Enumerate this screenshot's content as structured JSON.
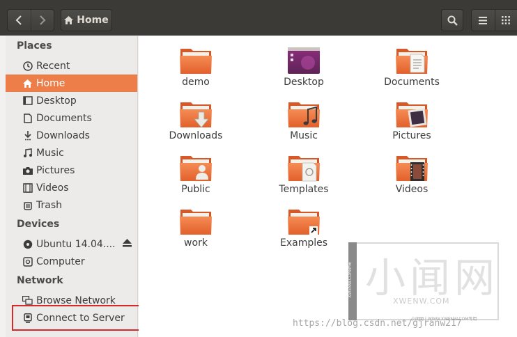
{
  "header": {
    "path_label": "Home",
    "icons": [
      "go-back-icon",
      "go-forward-icon",
      "home-icon",
      "search-icon",
      "list-view-icon",
      "grid-view-icon"
    ]
  },
  "sidebar": {
    "places_heading": "Places",
    "places": [
      {
        "label": "Recent",
        "icon": "recent-icon"
      },
      {
        "label": "Home",
        "icon": "home-icon",
        "active": true
      },
      {
        "label": "Desktop",
        "icon": "desktop-icon"
      },
      {
        "label": "Documents",
        "icon": "documents-icon"
      },
      {
        "label": "Downloads",
        "icon": "downloads-icon"
      },
      {
        "label": "Music",
        "icon": "music-icon"
      },
      {
        "label": "Pictures",
        "icon": "pictures-icon"
      },
      {
        "label": "Videos",
        "icon": "videos-icon"
      },
      {
        "label": "Trash",
        "icon": "trash-icon"
      }
    ],
    "devices_heading": "Devices",
    "devices": [
      {
        "label": "Ubuntu 14.04....",
        "icon": "disc-icon"
      },
      {
        "label": "Computer",
        "icon": "computer-icon"
      }
    ],
    "network_heading": "Network",
    "network": [
      {
        "label": "Browse Network",
        "icon": "network-icon"
      },
      {
        "label": "Connect to Server",
        "icon": "server-icon",
        "highlighted": true
      }
    ]
  },
  "files": [
    {
      "label": "demo",
      "icon": "folder-icon"
    },
    {
      "label": "Desktop",
      "icon": "desktop-folder-icon"
    },
    {
      "label": "Documents",
      "icon": "documents-folder-icon"
    },
    {
      "label": "Downloads",
      "icon": "downloads-folder-icon"
    },
    {
      "label": "Music",
      "icon": "music-folder-icon"
    },
    {
      "label": "Pictures",
      "icon": "pictures-folder-icon"
    },
    {
      "label": "Public",
      "icon": "public-folder-icon"
    },
    {
      "label": "Templates",
      "icon": "templates-folder-icon"
    },
    {
      "label": "Videos",
      "icon": "videos-folder-icon"
    },
    {
      "label": "work",
      "icon": "folder-icon"
    },
    {
      "label": "Examples",
      "icon": "examples-link-folder-icon"
    }
  ],
  "watermark": {
    "logo": "小闻网",
    "domain": "XWENW.COM",
    "strip": "小闻网 | WWW.XWENW.COM专用",
    "side": "XWENW.COM专用",
    "url": "https://blog.csdn.net/gjranw217"
  },
  "colors": {
    "accent": "#ed7e4a",
    "folder_orange": "#e96f3a",
    "headerbar": "#3b3a37",
    "highlight_border": "#d42a2a"
  }
}
